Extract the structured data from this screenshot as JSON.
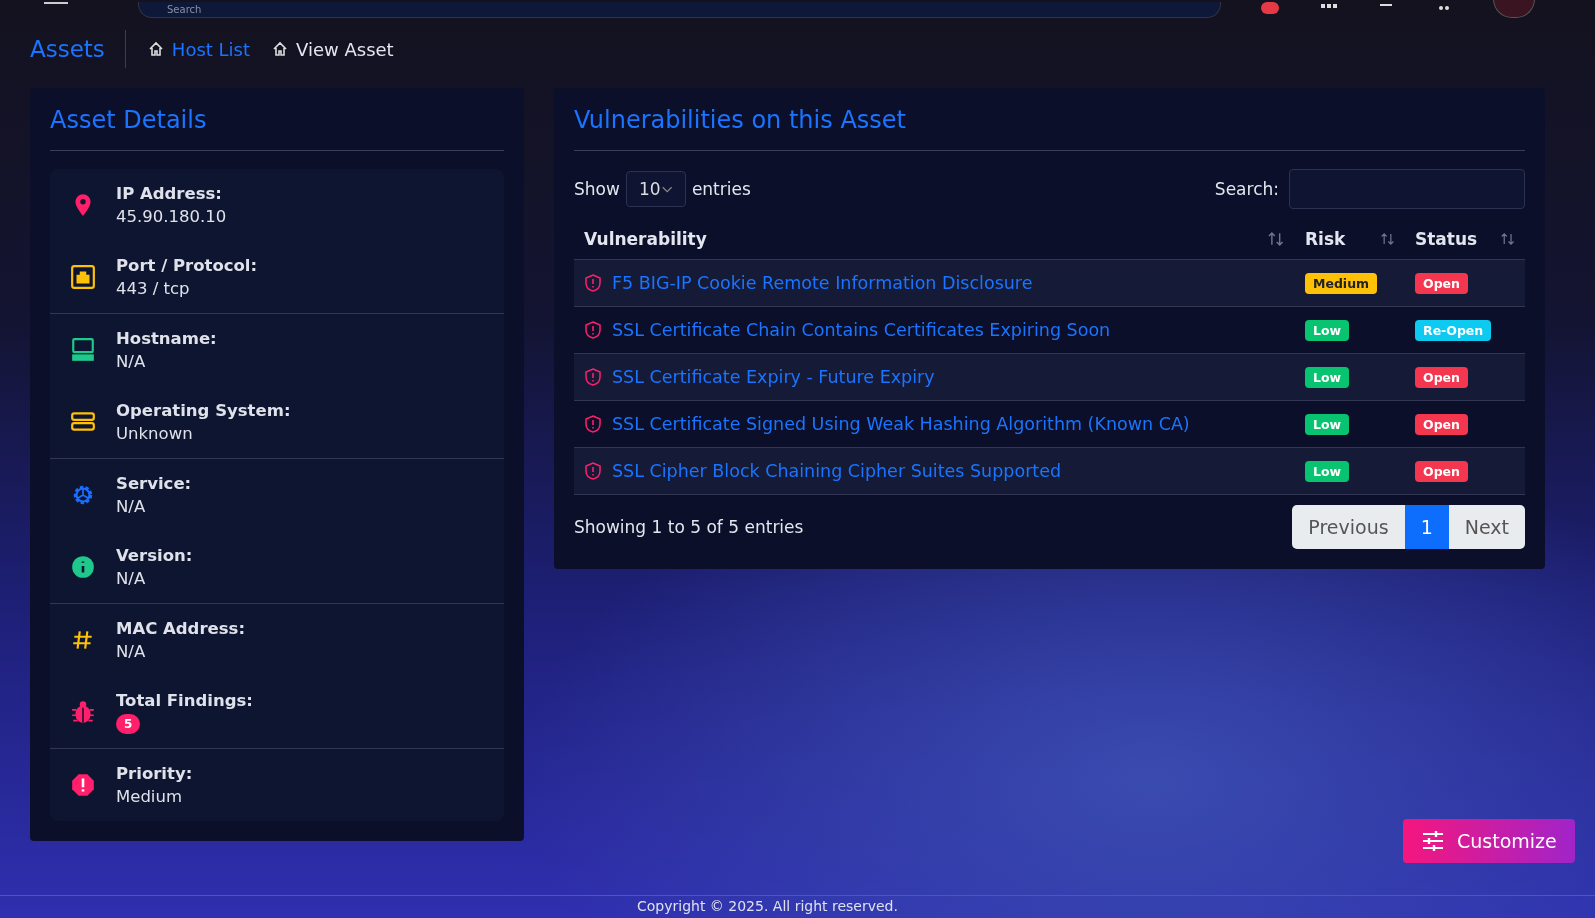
{
  "topbar": {
    "search_placeholder": "Search"
  },
  "breadcrumb": {
    "title": "Assets",
    "items": [
      {
        "label": "Host List",
        "link": true
      },
      {
        "label": "View Asset",
        "link": false
      }
    ]
  },
  "details": {
    "title": "Asset Details",
    "groups": [
      [
        {
          "label": "IP Address:",
          "value": "45.90.180.10",
          "kind": "text"
        },
        {
          "label": "Port / Protocol:",
          "value": "443 / tcp",
          "kind": "text"
        }
      ],
      [
        {
          "label": "Hostname:",
          "value": "N/A",
          "kind": "text"
        },
        {
          "label": "Operating System:",
          "value": "Unknown",
          "kind": "text"
        }
      ],
      [
        {
          "label": "Service:",
          "value": "N/A",
          "kind": "text"
        },
        {
          "label": "Version:",
          "value": "N/A",
          "kind": "text"
        }
      ],
      [
        {
          "label": "MAC Address:",
          "value": "N/A",
          "kind": "text"
        },
        {
          "label": "Total Findings:",
          "value": "5",
          "kind": "badge"
        }
      ],
      [
        {
          "label": "Priority:",
          "value": "Medium",
          "kind": "text"
        }
      ]
    ]
  },
  "vulns": {
    "title": "Vulnerabilities on this Asset",
    "show_label": "Show",
    "page_size": "10",
    "entries_label": "entries",
    "search_label": "Search:",
    "columns": [
      "Vulnerability",
      "Risk",
      "Status"
    ],
    "rows": [
      {
        "name": "F5 BIG-IP Cookie Remote Information Disclosure",
        "risk": {
          "text": "Medium",
          "color": "#ffc107"
        },
        "status": {
          "text": "Open",
          "color": "#f5364f"
        }
      },
      {
        "name": "SSL Certificate Chain Contains Certificates Expiring Soon",
        "risk": {
          "text": "Low",
          "color": "#08c36f"
        },
        "status": {
          "text": "Re-Open",
          "color": "#0dcaf0"
        }
      },
      {
        "name": "SSL Certificate Expiry - Future Expiry",
        "risk": {
          "text": "Low",
          "color": "#08c36f"
        },
        "status": {
          "text": "Open",
          "color": "#f5364f"
        }
      },
      {
        "name": "SSL Certificate Signed Using Weak Hashing Algorithm (Known CA)",
        "risk": {
          "text": "Low",
          "color": "#08c36f"
        },
        "status": {
          "text": "Open",
          "color": "#f5364f"
        }
      },
      {
        "name": "SSL Cipher Block Chaining Cipher Suites Supported",
        "risk": {
          "text": "Low",
          "color": "#08c36f"
        },
        "status": {
          "text": "Open",
          "color": "#f5364f"
        }
      }
    ],
    "info": "Showing 1 to 5 of 5 entries",
    "pagination": [
      {
        "label": "Previous",
        "selected": false
      },
      {
        "label": "1",
        "selected": true
      },
      {
        "label": "Next",
        "selected": false
      }
    ]
  },
  "customize": "Customize",
  "footer": "Copyright © 2025. All right reserved."
}
